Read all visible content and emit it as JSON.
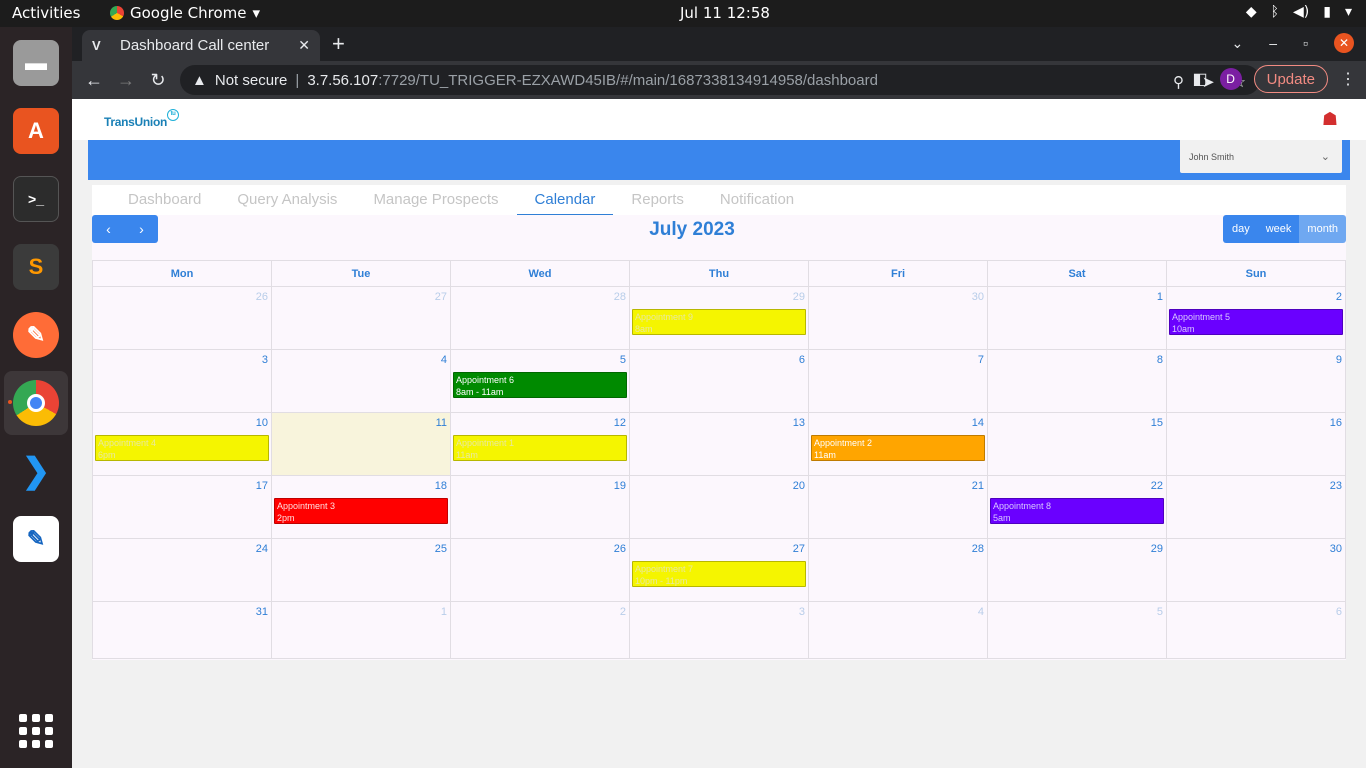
{
  "os": {
    "activities": "Activities",
    "app_name": "Google Chrome",
    "clock": "Jul 11  12:58"
  },
  "browser": {
    "tab_title": "Dashboard Call center",
    "tab_favicon": "V",
    "security_label": "Not secure",
    "url_host": "3.7.56.107",
    "url_path": ":7729/TU_TRIGGER-EZXAWD45IB/#/main/1687338134914958/dashboard",
    "profile_initial": "D",
    "update_label": "Update"
  },
  "app": {
    "logo_text": "TransUnion",
    "user_name": "John Smith",
    "nav_tabs": [
      {
        "label": "Dashboard",
        "active": false
      },
      {
        "label": "Query Analysis",
        "active": false
      },
      {
        "label": "Manage Prospects",
        "active": false
      },
      {
        "label": "Calendar",
        "active": true
      },
      {
        "label": "Reports",
        "active": false
      },
      {
        "label": "Notification",
        "active": false
      }
    ],
    "calendar": {
      "title": "July 2023",
      "views": [
        "day",
        "week",
        "month"
      ],
      "weekdays": [
        "Mon",
        "Tue",
        "Wed",
        "Thu",
        "Fri",
        "Sat",
        "Sun"
      ],
      "weeks": [
        [
          {
            "d": "26",
            "o": true
          },
          {
            "d": "27",
            "o": true
          },
          {
            "d": "28",
            "o": true
          },
          {
            "d": "29",
            "o": true,
            "ev": {
              "title": "Appointment 9",
              "time": "8am",
              "color": "#f5f500",
              "text": "#e8e8a0"
            }
          },
          {
            "d": "30",
            "o": true
          },
          {
            "d": "1"
          },
          {
            "d": "2",
            "ev": {
              "title": "Appointment 5",
              "time": "10am",
              "color": "#6a00ff",
              "text": "#d8c8ff"
            }
          }
        ],
        [
          {
            "d": "3"
          },
          {
            "d": "4"
          },
          {
            "d": "5",
            "ev": {
              "title": "Appointment 6",
              "time": "8am - 11am",
              "color": "#008a00",
              "text": "#ffffff"
            }
          },
          {
            "d": "6"
          },
          {
            "d": "7"
          },
          {
            "d": "8"
          },
          {
            "d": "9"
          }
        ],
        [
          {
            "d": "10",
            "ev": {
              "title": "Appointment 4",
              "time": "6pm",
              "color": "#f5f500",
              "text": "#e8e8a0"
            }
          },
          {
            "d": "11",
            "today": true
          },
          {
            "d": "12",
            "ev": {
              "title": "Appointment 1",
              "time": "11am",
              "color": "#f5f500",
              "text": "#e8e8a0"
            }
          },
          {
            "d": "13"
          },
          {
            "d": "14",
            "ev": {
              "title": "Appointment 2",
              "time": "11am",
              "color": "#ffa500",
              "text": "#ffffff"
            }
          },
          {
            "d": "15"
          },
          {
            "d": "16"
          }
        ],
        [
          {
            "d": "17"
          },
          {
            "d": "18",
            "ev": {
              "title": "Appointment 3",
              "time": "2pm",
              "color": "#ff0000",
              "text": "#ffe0e0"
            }
          },
          {
            "d": "19"
          },
          {
            "d": "20"
          },
          {
            "d": "21"
          },
          {
            "d": "22",
            "ev": {
              "title": "Appointment 8",
              "time": "5am",
              "color": "#6a00ff",
              "text": "#d8c8ff"
            }
          },
          {
            "d": "23"
          }
        ],
        [
          {
            "d": "24"
          },
          {
            "d": "25"
          },
          {
            "d": "26"
          },
          {
            "d": "27",
            "ev": {
              "title": "Appointment 7",
              "time": "10pm - 11pm",
              "color": "#f5f500",
              "text": "#e8e8a0"
            }
          },
          {
            "d": "28"
          },
          {
            "d": "29"
          },
          {
            "d": "30"
          }
        ],
        [
          {
            "d": "31"
          },
          {
            "d": "1",
            "o": true
          },
          {
            "d": "2",
            "o": true
          },
          {
            "d": "3",
            "o": true
          },
          {
            "d": "4",
            "o": true
          },
          {
            "d": "5",
            "o": true
          },
          {
            "d": "6",
            "o": true
          }
        ]
      ]
    }
  }
}
